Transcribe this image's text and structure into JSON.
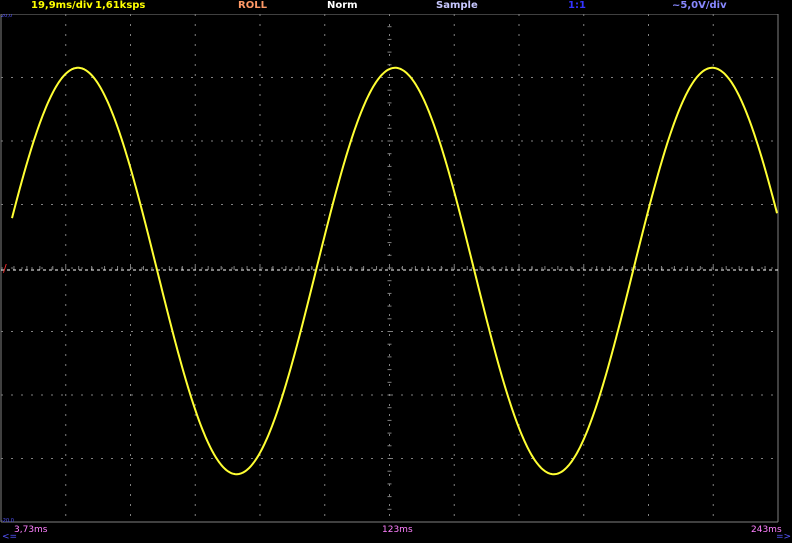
{
  "header": {
    "timebase": "19,9ms/div",
    "sample_rate": "1,61ksps",
    "mode": "ROLL",
    "trigger_mode": "Norm",
    "acquisition": "Sample",
    "probe": "1:1",
    "volts_per_div": "~5,0V/div"
  },
  "footer": {
    "left_arrow": "<=",
    "start_time": "3,73ms",
    "mid_time": "123ms",
    "end_time": "243ms",
    "right_arrow": "=>"
  },
  "scale_labels": {
    "top": "20,0",
    "bottom": "-20,0"
  },
  "colors": {
    "background": "#000000",
    "grid": "#808080",
    "trace": "#ffff33",
    "timebase": "#ffff00",
    "mode": "#ff9966",
    "trigger": "#ffffff",
    "acquisition": "#c8c8ff",
    "probe": "#3333ff",
    "volts": "#8888ff",
    "time_labels": "#ff80ff",
    "arrows": "#5555ff"
  },
  "chart_data": {
    "type": "line",
    "waveform": "sine",
    "amplitude_divisions": 3.2,
    "cycles_visible": 2.45,
    "horizontal_divisions": 12,
    "vertical_divisions": 8,
    "trigger_level_divisions": 0
  }
}
